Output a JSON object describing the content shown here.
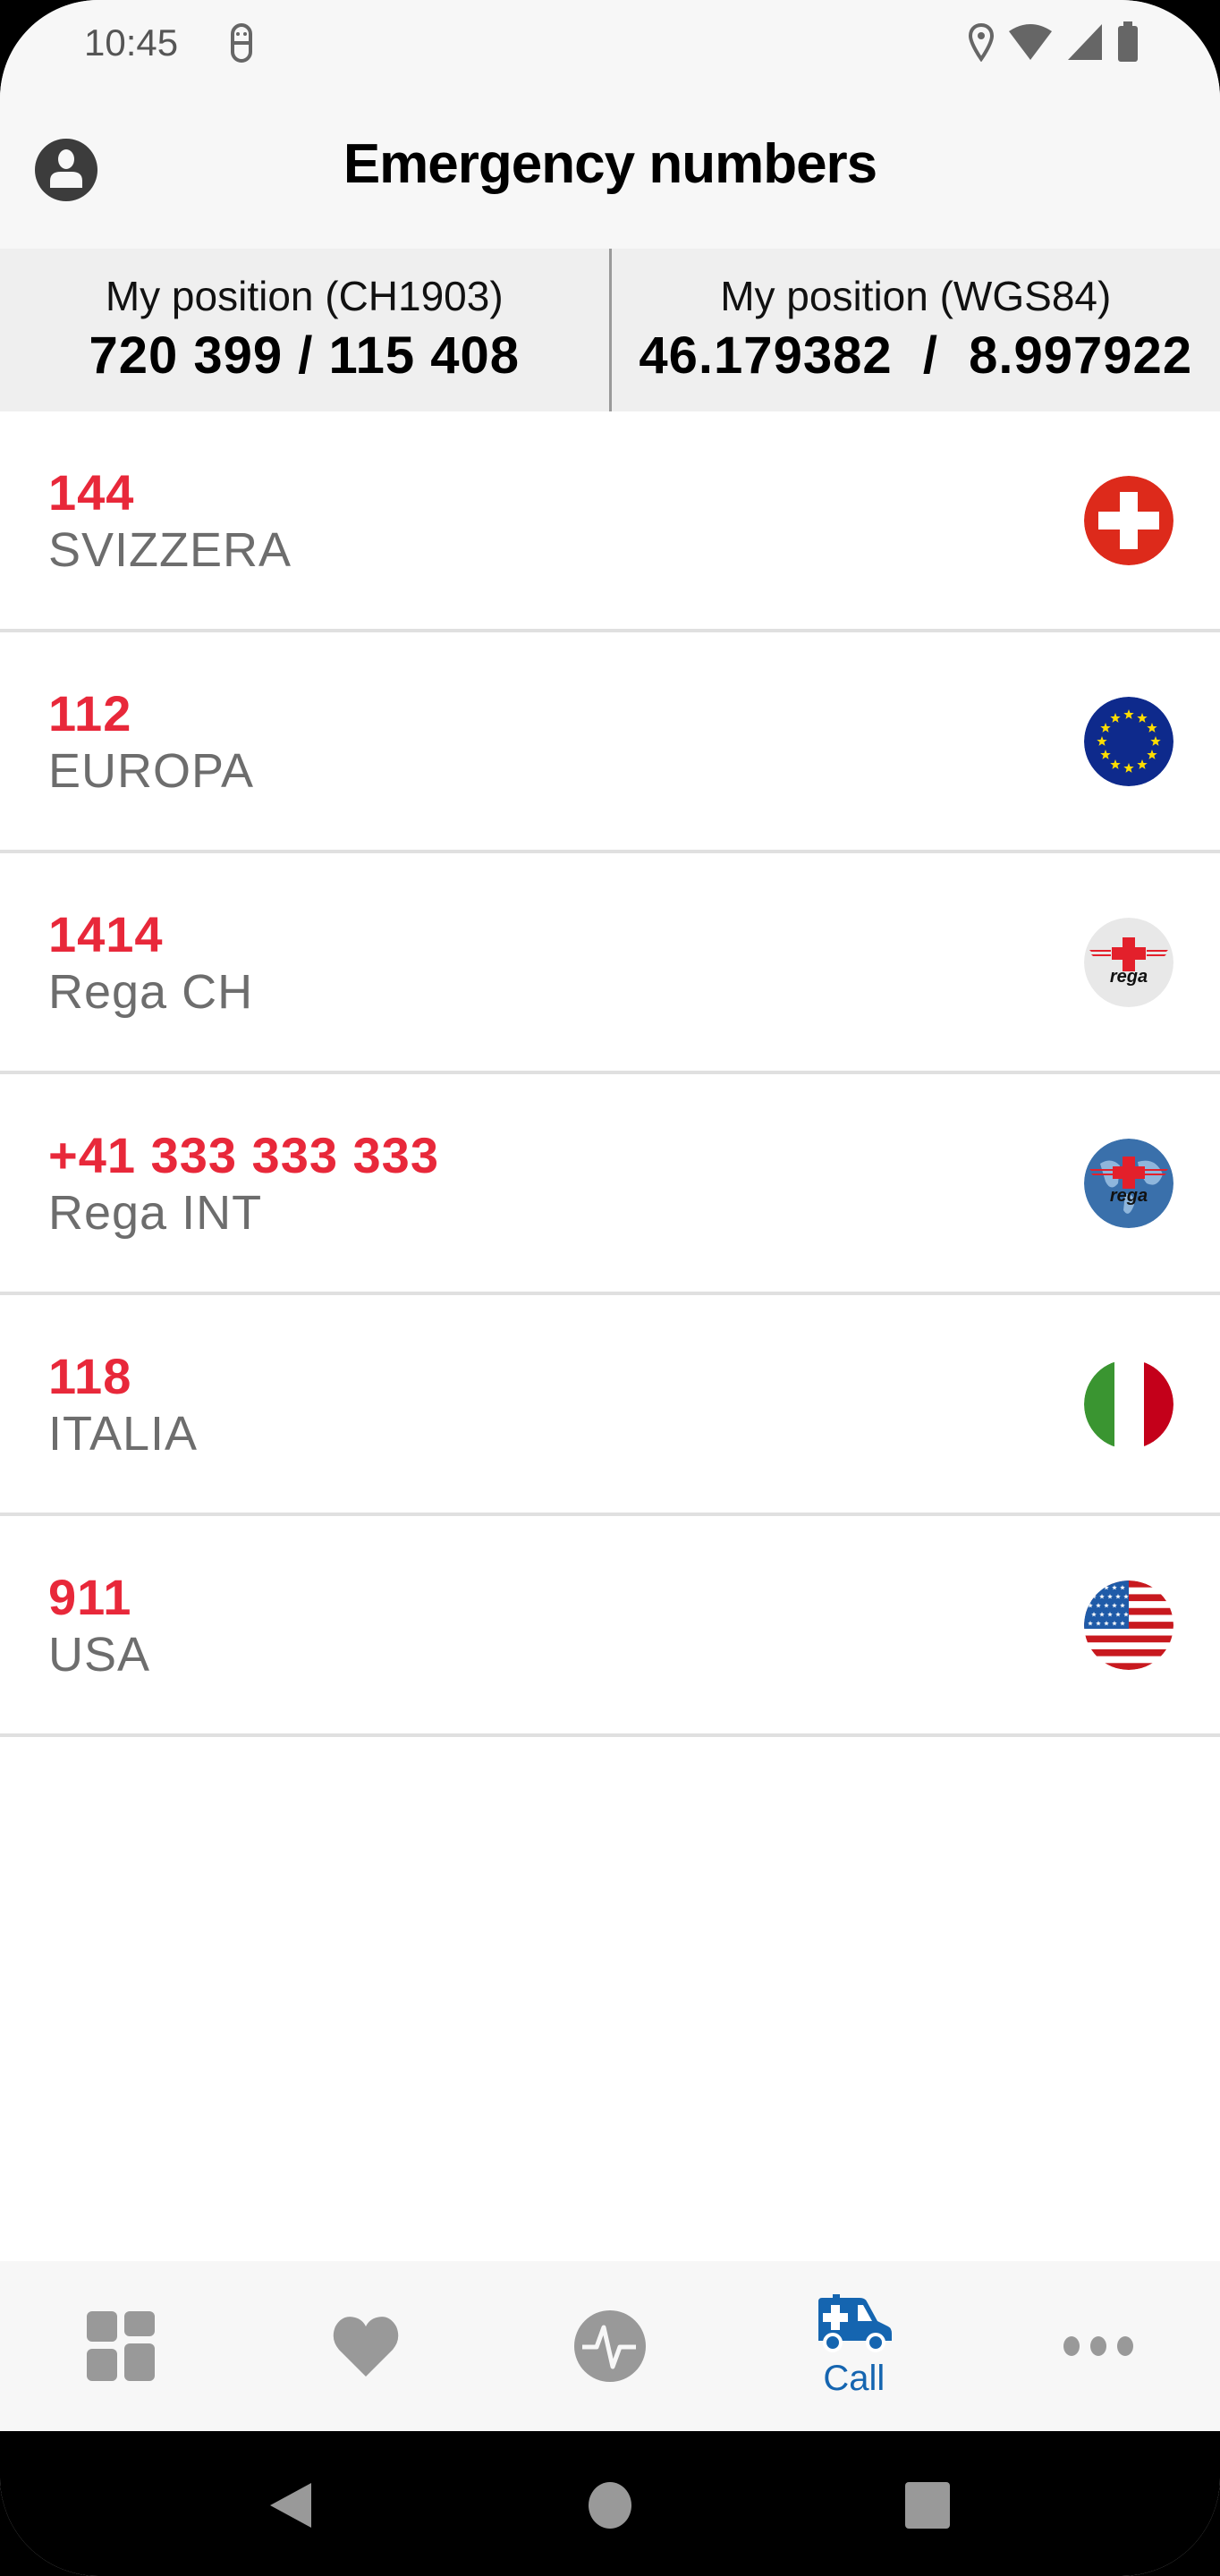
{
  "status_bar": {
    "time": "10:45",
    "icons": [
      "notification-icon",
      "location-icon",
      "wifi-icon",
      "signal-icon",
      "battery-icon"
    ]
  },
  "header": {
    "title": "Emergency numbers",
    "left_icon": "account-circle-icon"
  },
  "position": {
    "ch1903": {
      "label": "My position (CH1903)",
      "value": "720 399 / 115 408"
    },
    "wgs84": {
      "label": "My position (WGS84)",
      "value": "46.179382  /  8.997922"
    }
  },
  "emergency_numbers": [
    {
      "number": "144",
      "name": "SVIZZERA",
      "icon": "swiss-flag-icon"
    },
    {
      "number": "112",
      "name": "EUROPA",
      "icon": "eu-flag-icon"
    },
    {
      "number": "1414",
      "name": "Rega CH",
      "icon": "rega-ch-logo-icon"
    },
    {
      "number": "+41 333 333 333",
      "name": "Rega INT",
      "icon": "rega-int-logo-icon"
    },
    {
      "number": "118",
      "name": "ITALIA",
      "icon": "italy-flag-icon"
    },
    {
      "number": "911",
      "name": "USA",
      "icon": "usa-flag-icon"
    }
  ],
  "bottom_nav": {
    "items": [
      {
        "name": "dashboard",
        "icon": "dashboard-icon",
        "label": ""
      },
      {
        "name": "favorites",
        "icon": "heart-icon",
        "label": ""
      },
      {
        "name": "vitals",
        "icon": "pulse-icon",
        "label": ""
      },
      {
        "name": "call",
        "icon": "ambulance-icon",
        "label": "Call",
        "active": true
      },
      {
        "name": "more",
        "icon": "more-horizontal-icon",
        "label": ""
      }
    ]
  },
  "colors": {
    "accent_red": "#e8283a",
    "active_blue": "#1565b0",
    "inactive_gray": "#999999"
  }
}
